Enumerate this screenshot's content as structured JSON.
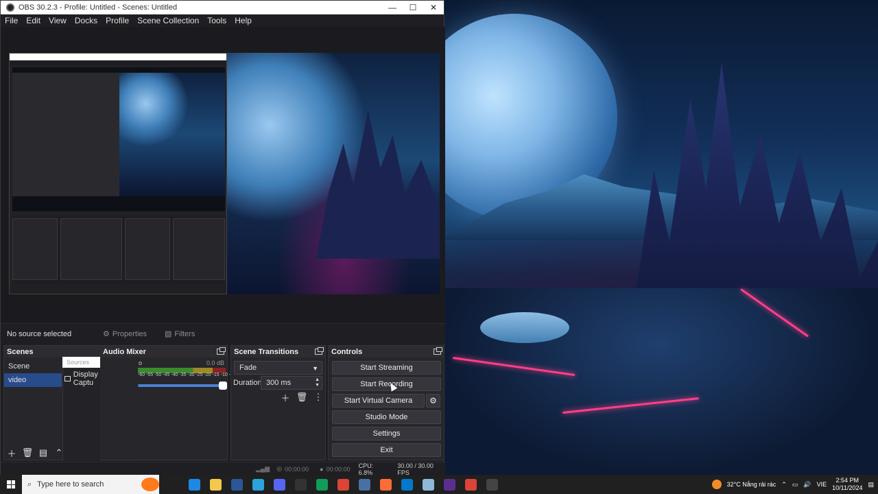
{
  "window": {
    "title": "OBS 30.2.3 - Profile: Untitled - Scenes: Untitled",
    "minimize": "—",
    "maximize": "☐",
    "close": "✕"
  },
  "menu": [
    "File",
    "Edit",
    "View",
    "Docks",
    "Profile",
    "Scene Collection",
    "Tools",
    "Help"
  ],
  "context_bar": {
    "no_source": "No source selected",
    "properties": "Properties",
    "filters": "Filters"
  },
  "scenes": {
    "title": "Scenes",
    "items": [
      "Scene",
      "video"
    ],
    "selected": "video"
  },
  "sources": {
    "placeholder": "Sources",
    "items": [
      {
        "label": "Display Captu",
        "icon": "monitor-icon"
      }
    ]
  },
  "audio_mixer": {
    "title": "Audio Mixer",
    "partial_label": "o",
    "level": "0.0 dB",
    "ticks": "-60 -55 -50 -45 -40 -35 -30 -25 -20 -15 -10 -5 0",
    "volume_fraction": 1.0
  },
  "transitions": {
    "title": "Scene Transitions",
    "selected": "Fade",
    "duration_label": "Duration",
    "duration_value": "300 ms"
  },
  "controls": {
    "title": "Controls",
    "start_streaming": "Start Streaming",
    "start_recording": "Start Recording",
    "start_virtual_camera": "Start Virtual Camera",
    "studio_mode": "Studio Mode",
    "settings": "Settings",
    "exit": "Exit"
  },
  "status_bar": {
    "stream_time": "00:00:00",
    "record_time": "00:00:00",
    "cpu": "CPU: 6.8%",
    "fps": "30.00 / 30.00 FPS"
  },
  "taskbar": {
    "search_placeholder": "Type here to search",
    "weather": "32°C  Nắng rải rác",
    "language": "VIE",
    "time": "2:54 PM",
    "date": "10/11/2024",
    "apps": [
      {
        "name": "task-view-icon",
        "color": "#202020"
      },
      {
        "name": "edge-icon",
        "color": "#1e88e5"
      },
      {
        "name": "file-explorer-icon",
        "color": "#f2c94c"
      },
      {
        "name": "word-icon",
        "color": "#2b5797"
      },
      {
        "name": "telegram-icon",
        "color": "#2aa3de"
      },
      {
        "name": "discord-icon",
        "color": "#5865f2"
      },
      {
        "name": "app-dark-icon",
        "color": "#333333"
      },
      {
        "name": "edge-2-icon",
        "color": "#0f9d58"
      },
      {
        "name": "chrome-icon",
        "color": "#db4437"
      },
      {
        "name": "settings-app-icon",
        "color": "#4a6fa5"
      },
      {
        "name": "postman-icon",
        "color": "#ff6c37"
      },
      {
        "name": "vscode-icon",
        "color": "#007acc"
      },
      {
        "name": "notepad-icon",
        "color": "#8fb8d8"
      },
      {
        "name": "visual-studio-icon",
        "color": "#5c2d91"
      },
      {
        "name": "chrome-2-icon",
        "color": "#db4437"
      },
      {
        "name": "obs-icon",
        "color": "#444444"
      }
    ]
  }
}
